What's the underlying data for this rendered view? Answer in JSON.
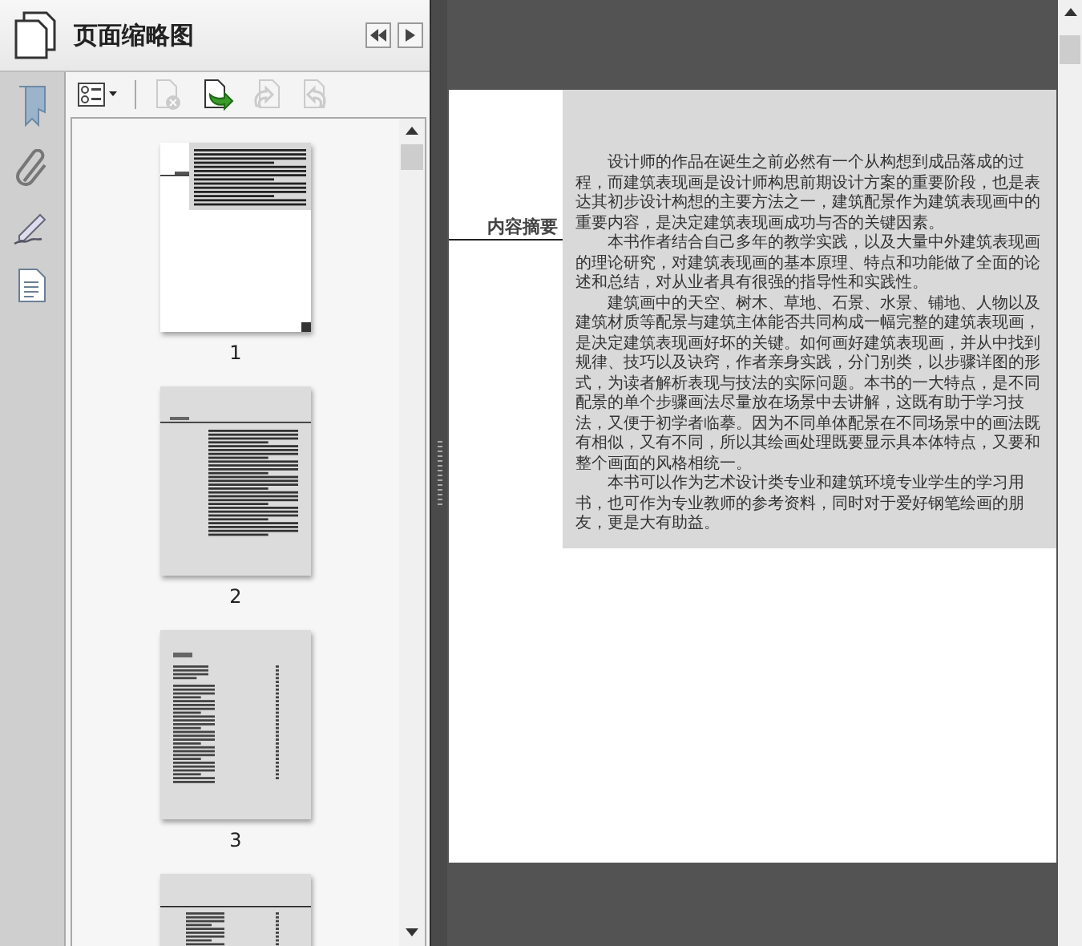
{
  "panel": {
    "title": "页面缩略图"
  },
  "toolbar": [
    {
      "kind": "options",
      "disabled": false
    },
    {
      "kind": "delete",
      "disabled": true
    },
    {
      "kind": "insert",
      "disabled": false
    },
    {
      "kind": "undo",
      "disabled": true
    },
    {
      "kind": "redo",
      "disabled": true
    }
  ],
  "thumbnails": [
    {
      "label": "1",
      "kind": "summary"
    },
    {
      "label": "2",
      "kind": "preface"
    },
    {
      "label": "3",
      "kind": "contents"
    },
    {
      "kind": "contents-continued"
    }
  ],
  "document": {
    "heading": "内容摘要",
    "paragraphs": [
      "设计师的作品在诞生之前必然有一个从构想到成品落成的过程，而建筑表现画是设计师构思前期设计方案的重要阶段，也是表达其初步设计构想的主要方法之一，建筑配景作为建筑表现画中的重要内容，是决定建筑表现画成功与否的关键因素。",
      "本书作者结合自己多年的教学实践，以及大量中外建筑表现画的理论研究，对建筑表现画的基本原理、特点和功能做了全面的论述和总结，对从业者具有很强的指导性和实践性。",
      "建筑画中的天空、树木、草地、石景、水景、铺地、人物以及建筑材质等配景与建筑主体能否共同构成一幅完整的建筑表现画，是决定建筑表现画好坏的关键。如何画好建筑表现画，并从中找到规律、技巧以及诀窍，作者亲身实践，分门别类，以步骤详图的形式，为读者解析表现与技法的实际问题。本书的一大特点，是不同配景的单个步骤画法尽量放在场景中去讲解，这既有助于学习技法，又便于初学者临摹。因为不同单体配景在不同场景中的画法既有相似，又有不同，所以其绘画处理既要显示具本体特点，又要和整个画面的风格相统一。",
      "本书可以作为艺术设计类专业和建筑环境专业学生的学习用书，也可作为专业教师的参考资料，同时对于爱好钢笔绘画的朋友，更是大有助益。"
    ]
  }
}
